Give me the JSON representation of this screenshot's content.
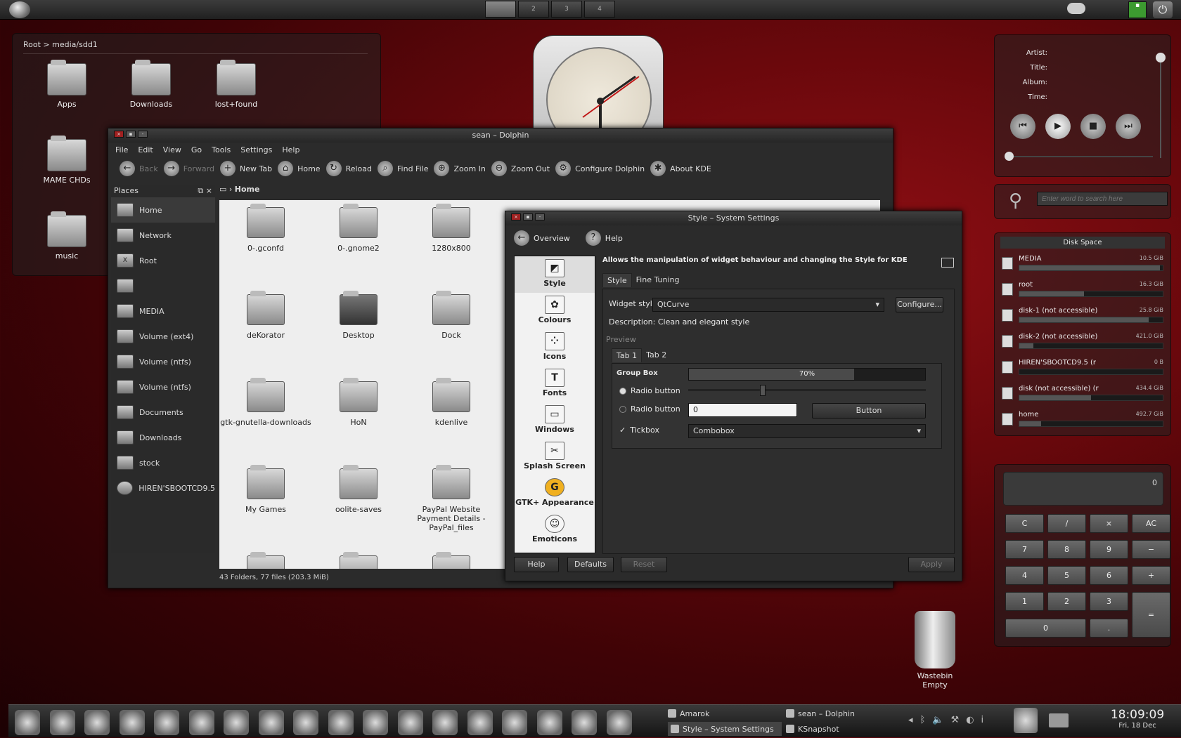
{
  "topbar": {
    "pager": [
      "",
      "2",
      "3",
      "4"
    ]
  },
  "folderview": {
    "path": "Root > media/sdd1",
    "items": [
      "Apps",
      "Downloads",
      "lost+found",
      "MAME CHDs",
      "music"
    ]
  },
  "dolphin": {
    "title": "sean – Dolphin",
    "menu": [
      "File",
      "Edit",
      "View",
      "Go",
      "Tools",
      "Settings",
      "Help"
    ],
    "toolbar": {
      "back": "Back",
      "forward": "Forward",
      "new_tab": "New Tab",
      "home": "Home",
      "reload": "Reload",
      "find": "Find File",
      "zoom_in": "Zoom In",
      "zoom_out": "Zoom Out",
      "configure": "Configure Dolphin",
      "about": "About KDE"
    },
    "places_title": "Places",
    "places": [
      "Home",
      "Network",
      "Root",
      "",
      "MEDIA",
      "Volume (ext4)",
      "Volume (ntfs)",
      "Volume (ntfs)",
      "Documents",
      "Downloads",
      "stock",
      "HIREN'SBOOTCD9.5"
    ],
    "breadcrumb": "Home",
    "files": [
      "0-.gconfd",
      "0-.gnome2",
      "1280x800",
      "deKorator",
      "Desktop",
      "Dock",
      "gtk-gnutella-downloads",
      "HoN",
      "kdenlive",
      "My Games",
      "oolite-saves",
      "PayPal Website Payment Details - PayPal_files"
    ],
    "status": "43 Folders, 77 files (203.3 MiB)"
  },
  "settings": {
    "title": "Style – System Settings",
    "overview": "Overview",
    "help_nav": "Help",
    "sidebar": [
      "Style",
      "Colours",
      "Icons",
      "Fonts",
      "Windows",
      "Splash Screen",
      "GTK+ Appearance",
      "Emoticons"
    ],
    "heading": "Allows the manipulation of widget behaviour and changing the Style for KDE",
    "tabs": [
      "Style",
      "Fine Tuning"
    ],
    "widget_style_label": "Widget style:",
    "widget_style_value": "QtCurve",
    "configure": "Configure...",
    "description": "Description: Clean and elegant style",
    "preview_label": "Preview",
    "preview_tabs": [
      "Tab 1",
      "Tab 2"
    ],
    "group_box": "Group Box",
    "progress": "70%",
    "progress_value": 0.7,
    "radio1": "Radio button",
    "radio2": "Radio button",
    "spin_value": "0",
    "button": "Button",
    "tickbox": "Tickbox",
    "combobox": "Combobox",
    "bottom": {
      "help": "Help",
      "defaults": "Defaults",
      "reset": "Reset",
      "apply": "Apply"
    }
  },
  "nowplaying": {
    "artist": "Artist:",
    "title": "Title:",
    "album": "Album:",
    "time": "Time:"
  },
  "search": {
    "placeholder": "Enter word to search here"
  },
  "disk": {
    "title": "Disk Space",
    "rows": [
      {
        "name": "MEDIA",
        "size": "10.5 GiB",
        "fill": 0.98
      },
      {
        "name": "root",
        "size": "16.3 GiB",
        "fill": 0.45
      },
      {
        "name": "disk-1 (not accessible)",
        "size": "25.8 GiB",
        "fill": 0.9
      },
      {
        "name": "disk-2 (not accessible)",
        "size": "421.0 GiB",
        "fill": 0.1
      },
      {
        "name": "HIREN'SBOOTCD9.5 (r",
        "size": "0 B",
        "fill": 0.0
      },
      {
        "name": "disk (not accessible) (r",
        "size": "434.4 GiB",
        "fill": 0.5
      },
      {
        "name": "home",
        "size": "492.7 GiB",
        "fill": 0.15
      }
    ]
  },
  "calculator": {
    "display": "0",
    "keys": [
      "C",
      "/",
      "×",
      "AC",
      "7",
      "8",
      "9",
      "−",
      "4",
      "5",
      "6",
      "+",
      "1",
      "2",
      "3",
      "=",
      "0",
      "."
    ]
  },
  "wastebin": {
    "label": "Wastebin",
    "status": "Empty"
  },
  "taskbar": {
    "tasks": [
      "Amarok",
      "sean – Dolphin",
      "Style – System Settings",
      "KSnapshot"
    ],
    "time": "18:09:09",
    "date": "Fri, 18 Dec"
  }
}
